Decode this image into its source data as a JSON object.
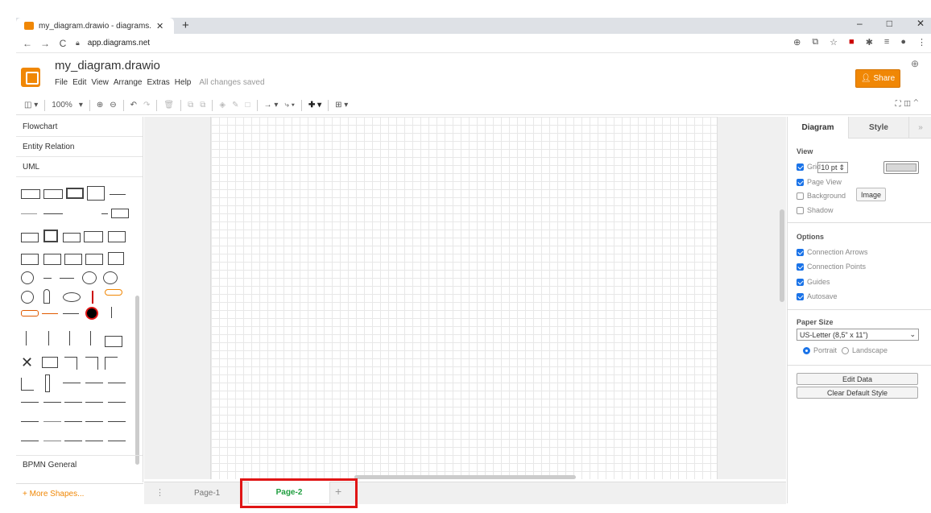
{
  "browser": {
    "tab_title": "my_diagram.drawio - diagrams.n",
    "tab_close": "✕",
    "new_tab": "+",
    "window_controls": [
      "–",
      "□",
      "✕"
    ],
    "url": "app.diagrams.net",
    "nav": [
      "←",
      "→",
      "C"
    ]
  },
  "app": {
    "title": "my_diagram.drawio",
    "menus": [
      "File",
      "Edit",
      "View",
      "Arrange",
      "Extras",
      "Help"
    ],
    "status": "All changes saved",
    "share_label": "Share"
  },
  "toolbar": {
    "zoom": "100%"
  },
  "sidebar": {
    "categories": [
      "Flowchart",
      "Entity Relation",
      "UML"
    ],
    "bottom_category": "BPMN General",
    "more_shapes": "+ More Shapes..."
  },
  "pages": {
    "tabs": [
      "Page-1",
      "Page-2"
    ],
    "active": "Page-2",
    "add": "+"
  },
  "format_panel": {
    "tabs": [
      "Diagram",
      "Style"
    ],
    "view_heading": "View",
    "grid_label": "Grid",
    "grid_size": "10 pt",
    "page_view_label": "Page View",
    "background_label": "Background",
    "image_button": "Image",
    "shadow_label": "Shadow",
    "options_heading": "Options",
    "connection_arrows": "Connection Arrows",
    "connection_points": "Connection Points",
    "guides": "Guides",
    "autosave": "Autosave",
    "paper_size_heading": "Paper Size",
    "paper_size_value": "US-Letter (8,5\" x 11\")",
    "portrait": "Portrait",
    "landscape": "Landscape",
    "edit_data": "Edit Data",
    "clear_default_style": "Clear Default Style"
  },
  "colors": {
    "accent": "#f08705",
    "highlight_box": "#e01515",
    "active_page_text": "#1e9e3e"
  }
}
